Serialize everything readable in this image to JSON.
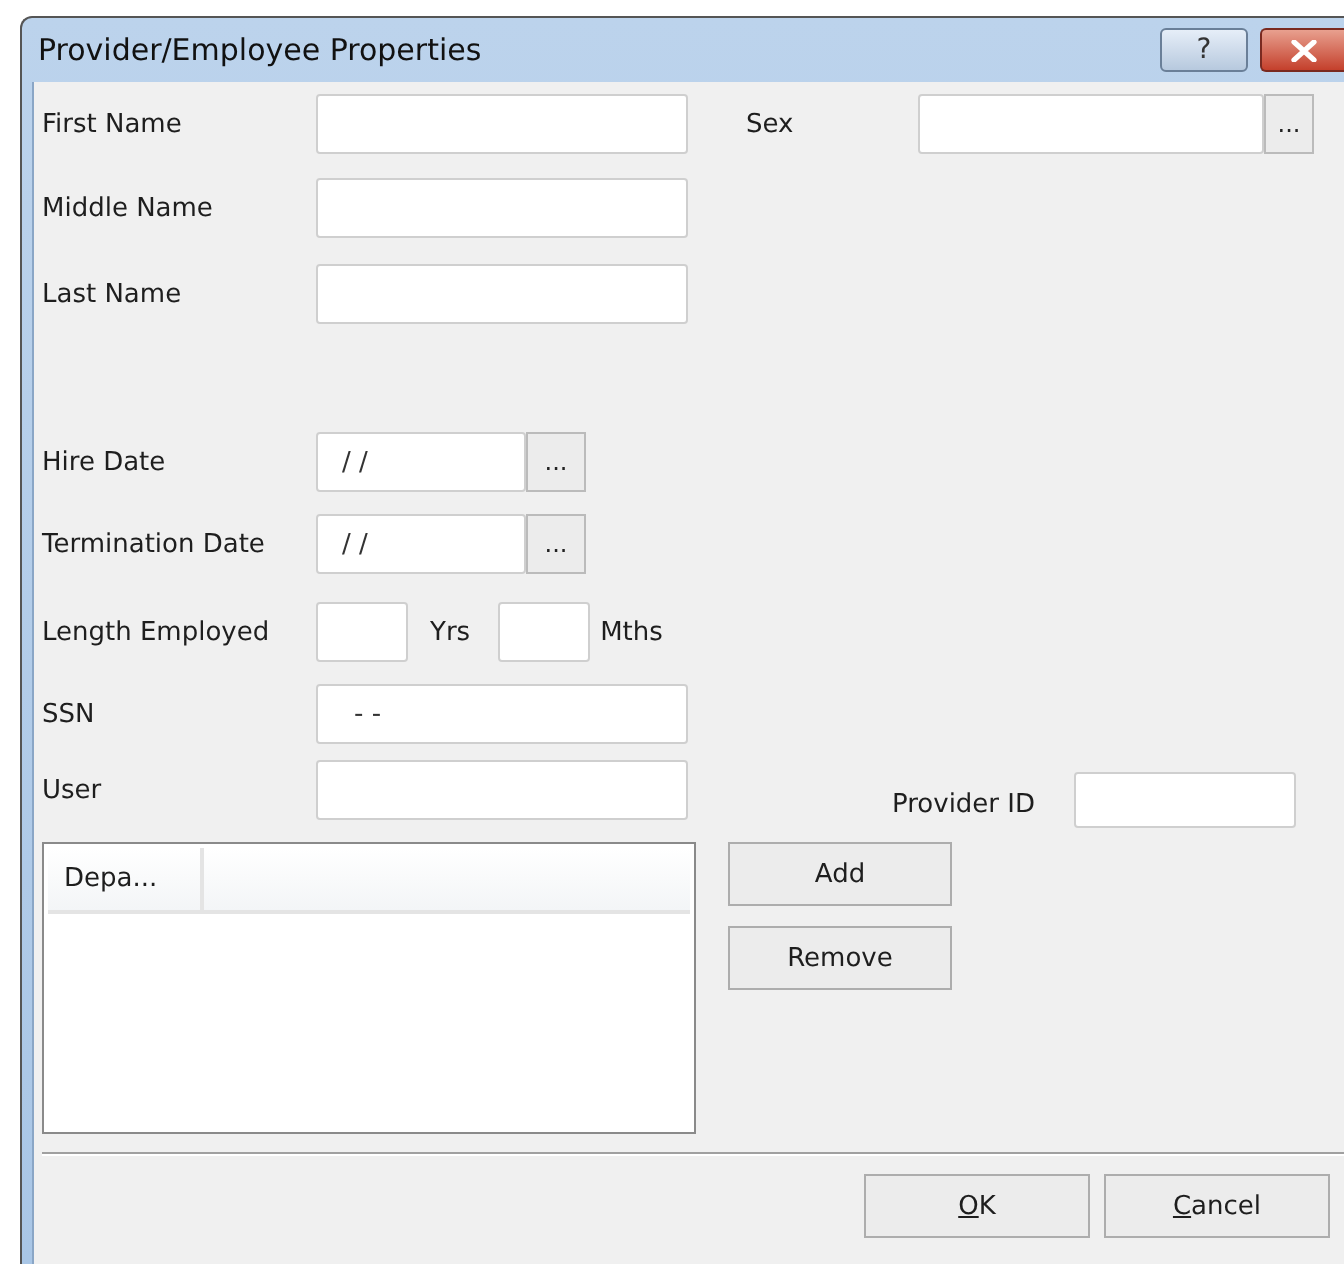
{
  "window": {
    "title": "Provider/Employee Properties",
    "help_glyph": "?"
  },
  "fields": [
    {
      "kind": "text",
      "label": "First Name"
    },
    {
      "kind": "text",
      "label": "Middle Name"
    },
    {
      "kind": "text",
      "label": "Last Name"
    },
    {
      "kind": "date",
      "label": "Hire Date",
      "value": "/ /",
      "browse": "..."
    },
    {
      "kind": "date",
      "label": "Termination Date",
      "value": "/ /",
      "browse": "..."
    },
    {
      "kind": "length",
      "label": "Length Employed",
      "years_unit": "Yrs",
      "months_unit": "Mths"
    },
    {
      "kind": "text",
      "label": "SSN",
      "value": "- -"
    },
    {
      "kind": "text",
      "label": "User"
    }
  ],
  "sex": {
    "label": "Sex",
    "browse": "..."
  },
  "provider_id": {
    "label": "Provider ID"
  },
  "department_list": {
    "columns": [
      "Depa..."
    ]
  },
  "list_buttons": [
    "Add",
    "Remove"
  ],
  "footer_buttons": [
    {
      "label": "OK",
      "underlined_access_key": true
    },
    {
      "label": "Cancel",
      "underlined_access_key": true
    }
  ]
}
